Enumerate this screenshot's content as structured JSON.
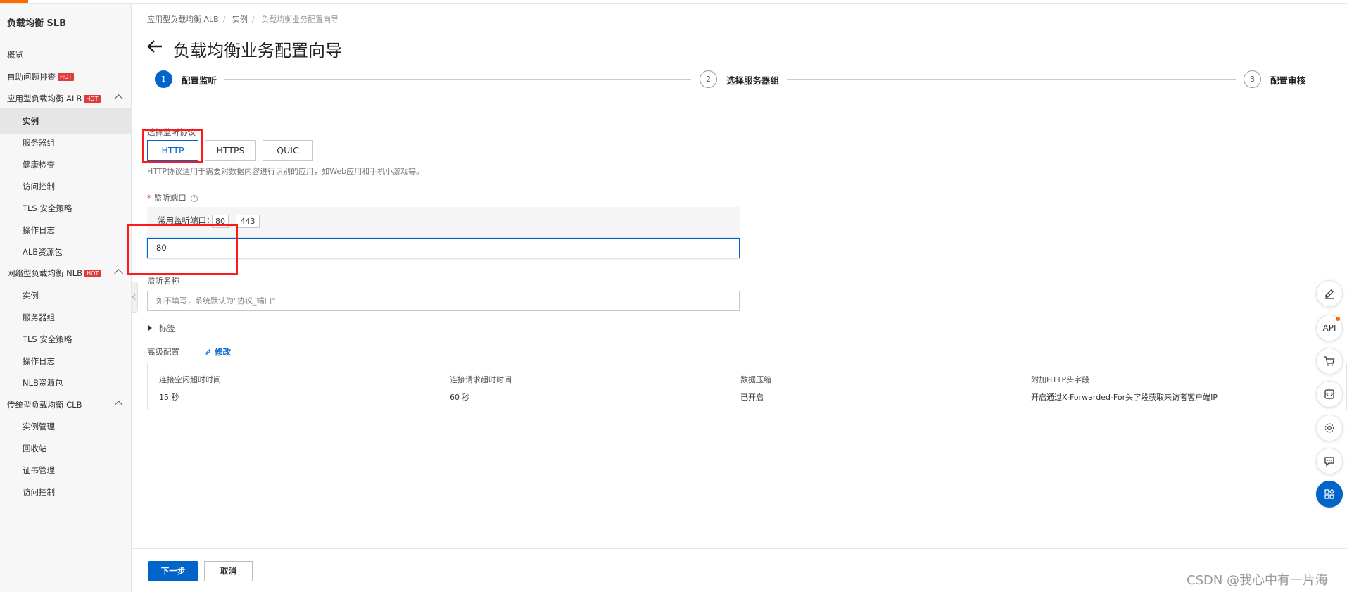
{
  "colors": {
    "accent": "#0064c8",
    "hot": "#e03a3a",
    "annotation": "#ff1a1a",
    "brand_orange": "#ff6a00"
  },
  "sidebar": {
    "title": "负载均衡 SLB",
    "items": [
      {
        "label": "概览"
      },
      {
        "label": "自助问题排查",
        "badge": "HOT"
      },
      {
        "label": "应用型负载均衡 ALB",
        "badge": "HOT",
        "expanded": true
      },
      {
        "label": "实例",
        "active": true
      },
      {
        "label": "服务器组"
      },
      {
        "label": "健康检查"
      },
      {
        "label": "访问控制"
      },
      {
        "label": "TLS 安全策略"
      },
      {
        "label": "操作日志"
      },
      {
        "label": "ALB资源包"
      },
      {
        "label": "网络型负载均衡 NLB",
        "badge": "HOT",
        "expanded": true
      },
      {
        "label": "实例"
      },
      {
        "label": "服务器组"
      },
      {
        "label": "TLS 安全策略"
      },
      {
        "label": "操作日志"
      },
      {
        "label": "NLB资源包"
      },
      {
        "label": "传统型负载均衡 CLB",
        "expanded": true
      },
      {
        "label": "实例管理"
      },
      {
        "label": "回收站"
      },
      {
        "label": "证书管理"
      },
      {
        "label": "访问控制"
      }
    ]
  },
  "breadcrumb": [
    "应用型负载均衡 ALB",
    "实例",
    "负载均衡业务配置向导"
  ],
  "page_title": "负载均衡业务配置向导",
  "steps": [
    {
      "num": "1",
      "label": "配置监听",
      "active": true
    },
    {
      "num": "2",
      "label": "选择服务器组"
    },
    {
      "num": "3",
      "label": "配置审核"
    }
  ],
  "protocol": {
    "label": "选择监听协议",
    "options": [
      "HTTP",
      "HTTPS",
      "QUIC"
    ],
    "selected": "HTTP",
    "hint": "HTTP协议适用于需要对数据内容进行识别的应用，如Web应用和手机小游戏等。"
  },
  "port": {
    "label": "监听端口",
    "common_label": "常用监听端口：",
    "common_ports": [
      "80",
      "443"
    ],
    "value": "80"
  },
  "listener_name": {
    "label": "监听名称",
    "placeholder": "如不填写，系统默认为\"协议_端口\""
  },
  "tags_label": "标签",
  "advanced": {
    "label": "高级配置",
    "edit_label": "修改",
    "columns": [
      {
        "header": "连接空闲超时时间",
        "value": "15 秒"
      },
      {
        "header": "连接请求超时时间",
        "value": "60 秒"
      },
      {
        "header": "数据压缩",
        "value": "已开启"
      },
      {
        "header": "附加HTTP头字段",
        "value": "开启通过X-Forwarded-For头字段获取来访者客户端IP"
      }
    ]
  },
  "footer": {
    "next_label": "下一步",
    "cancel_label": "取消"
  },
  "float_toolbar": [
    "edit-icon",
    "api-icon",
    "cart-icon",
    "code-icon",
    "gear-icon",
    "chat-icon",
    "apps-icon"
  ],
  "float_api_text": "API",
  "watermark": "CSDN @我心中有一片海"
}
